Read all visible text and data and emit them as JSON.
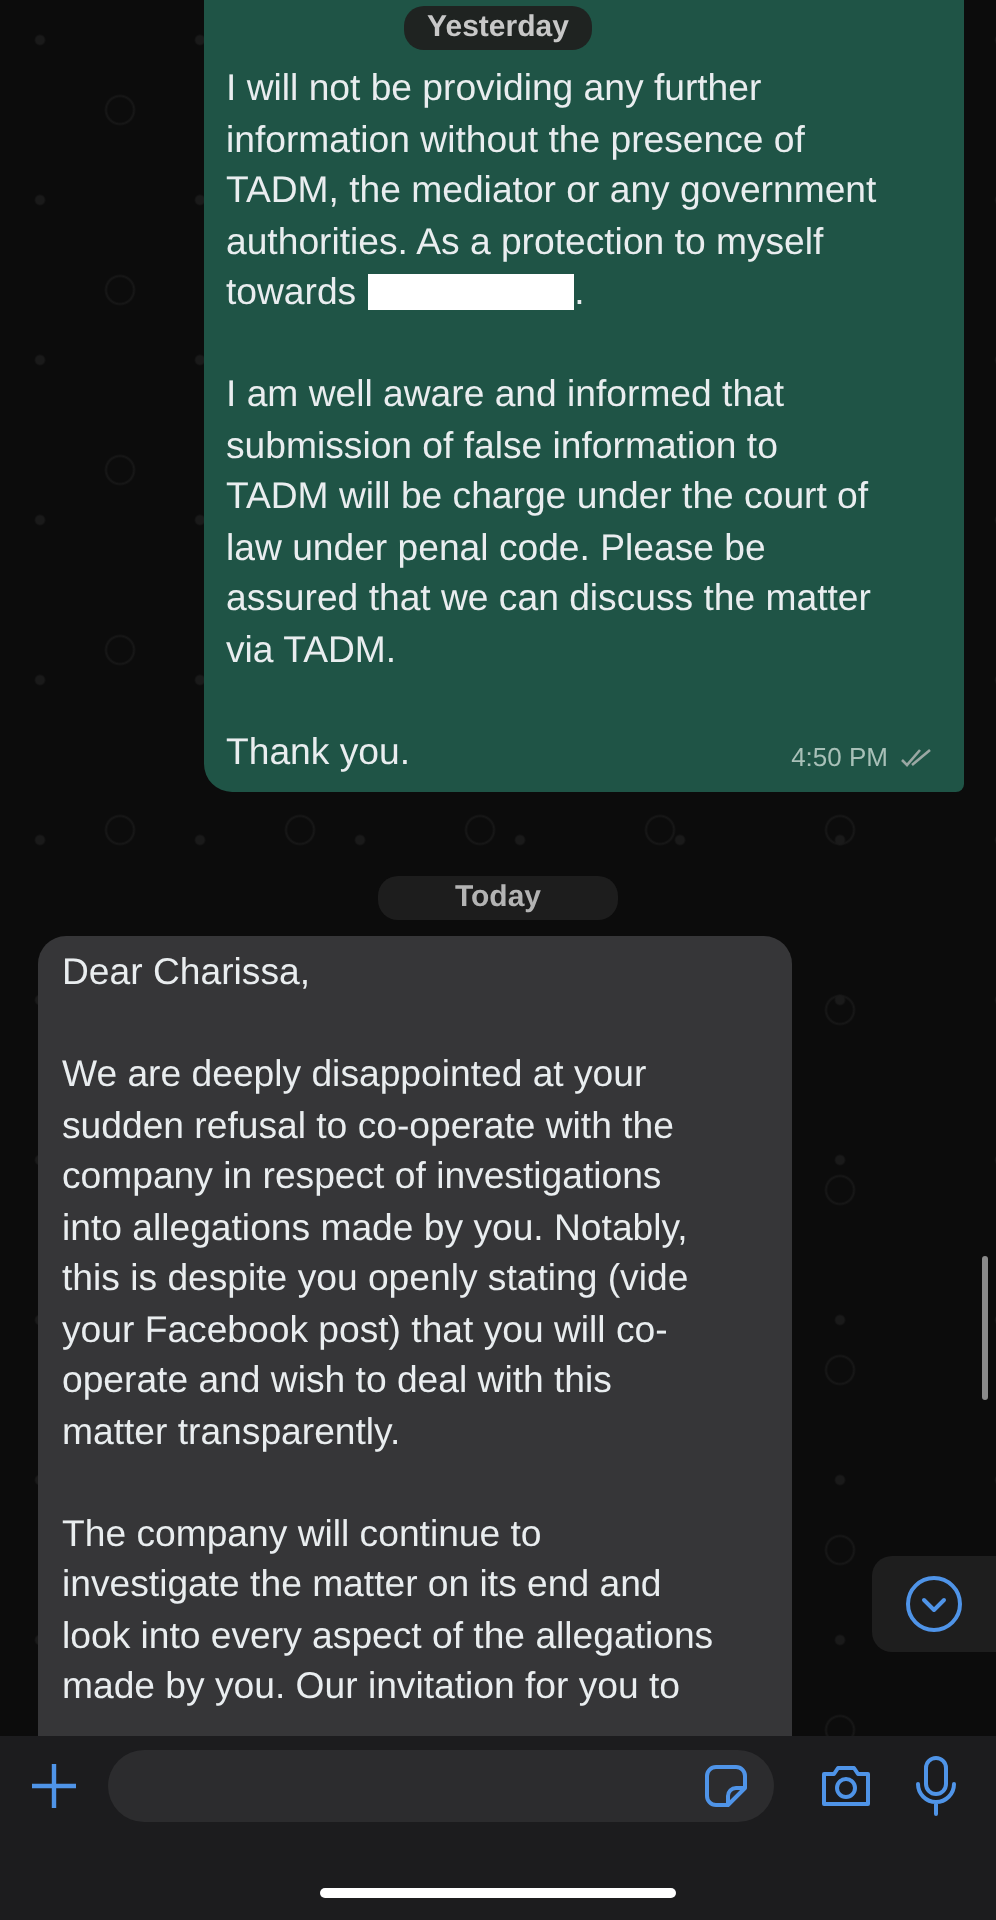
{
  "chat": {
    "sticky_date": "Yesterday",
    "messages": [
      {
        "kind": "outgoing",
        "time": "4:50 PM",
        "read": false,
        "paragraphs": [
          {
            "lines": [
              "I will not be providing any further",
              "information without the presence of",
              "TADM, the mediator or any government",
              "authorities. As a protection to myself",
              "towards"
            ],
            "redacted": true,
            "after": "."
          },
          {
            "lines": [
              "I am well aware and informed that",
              "submission of false information to",
              "TADM will be charge under the court of",
              "law under penal code. Please be",
              "assured that we can discuss the matter",
              "via TADM."
            ],
            "redacted": false
          },
          {
            "lines": [
              "Thank you."
            ],
            "redacted": false
          }
        ]
      },
      {
        "kind": "date",
        "label": "Today"
      },
      {
        "kind": "incoming",
        "paragraphs": [
          {
            "lines": [
              "Dear Charissa,"
            ],
            "redacted": false
          },
          {
            "lines": [
              "We are deeply disappointed at your",
              "sudden refusal to co-operate with the",
              "company in respect of investigations",
              "into allegations made by you. Notably,",
              "this is despite you openly stating (vide",
              "your Facebook post) that you will co-",
              "operate and wish to deal with this",
              "matter transparently."
            ],
            "redacted": false
          },
          {
            "lines": [
              "The company will continue to",
              "investigate the matter on its end and",
              "look into every aspect of the allegations",
              "made by you. Our invitation for you to"
            ],
            "redacted": false
          }
        ]
      }
    ]
  }
}
